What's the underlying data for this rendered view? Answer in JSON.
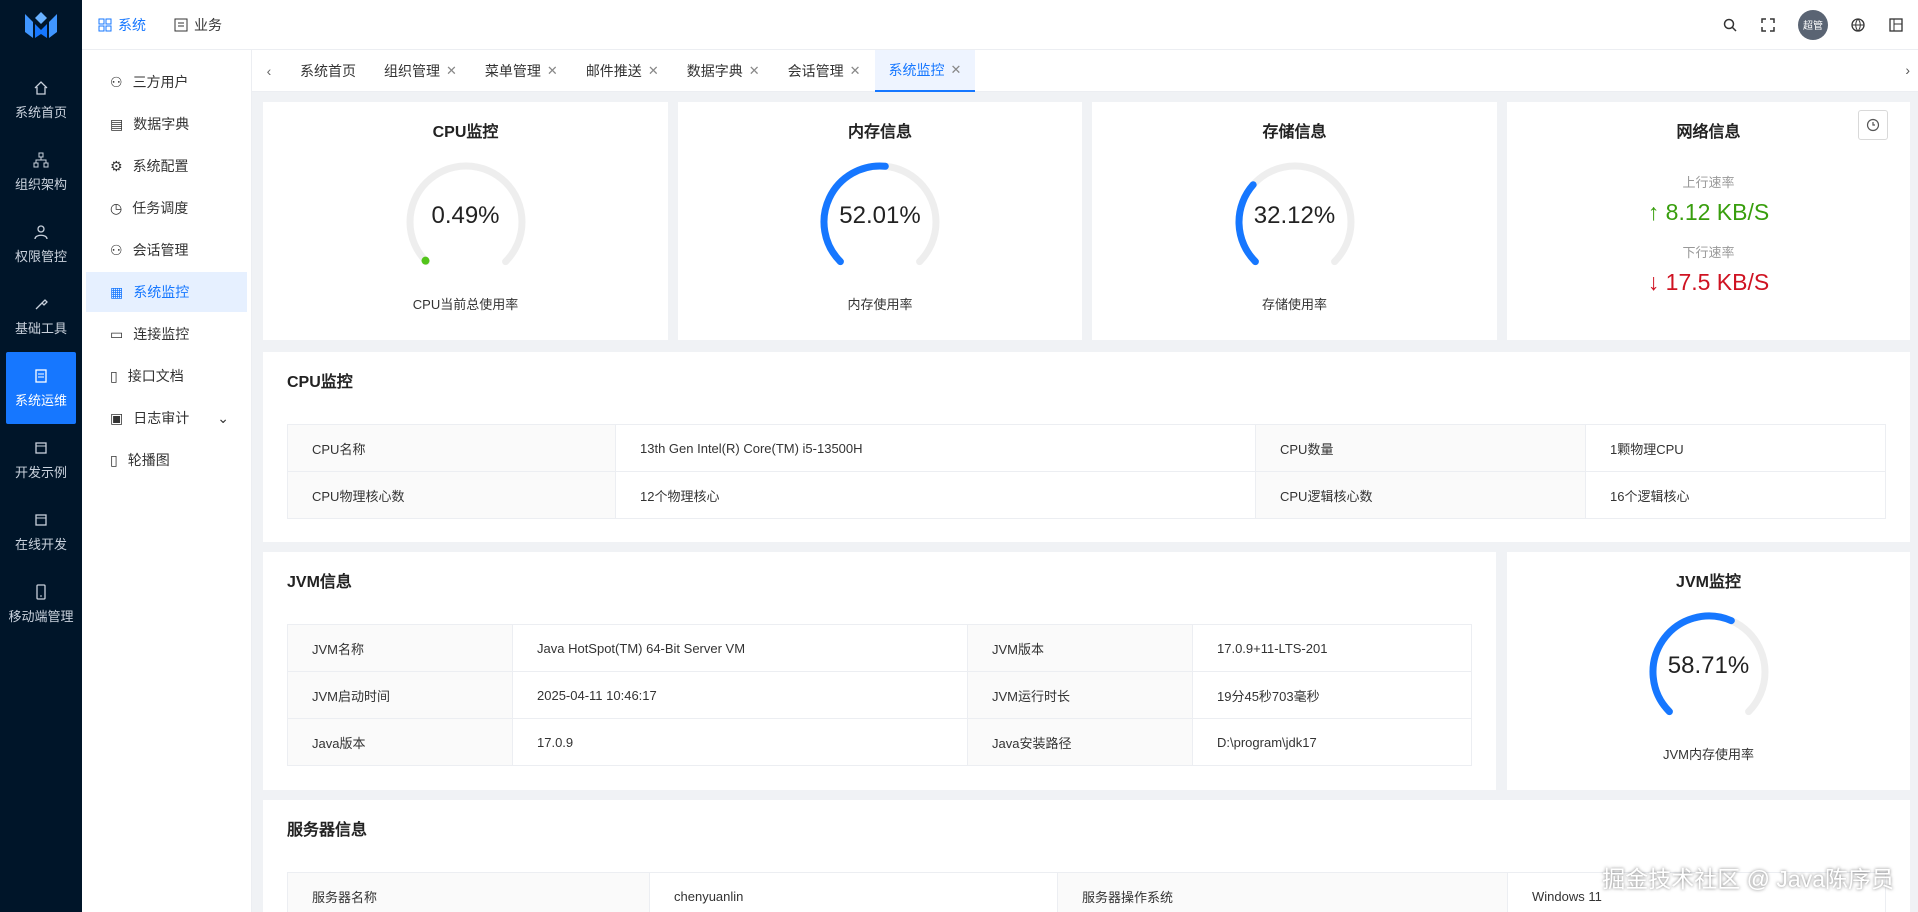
{
  "rail": {
    "items": [
      {
        "label": "系统首页",
        "icon": "home-icon"
      },
      {
        "label": "组织架构",
        "icon": "org-icon"
      },
      {
        "label": "权限管控",
        "icon": "user-icon"
      },
      {
        "label": "基础工具",
        "icon": "wrench-icon"
      },
      {
        "label": "系统运维",
        "icon": "doc-icon"
      },
      {
        "label": "开发示例",
        "icon": "box-icon"
      },
      {
        "label": "在线开发",
        "icon": "box-icon"
      },
      {
        "label": "移动端管理",
        "icon": "phone-icon"
      }
    ]
  },
  "header": {
    "menu": [
      {
        "label": "系统"
      },
      {
        "label": "业务"
      }
    ],
    "avatar_text": "超管"
  },
  "sidemenu": {
    "items": [
      {
        "label": "三方用户"
      },
      {
        "label": "数据字典"
      },
      {
        "label": "系统配置"
      },
      {
        "label": "任务调度"
      },
      {
        "label": "会话管理"
      },
      {
        "label": "系统监控"
      },
      {
        "label": "连接监控"
      },
      {
        "label": "接口文档"
      },
      {
        "label": "日志审计"
      },
      {
        "label": "轮播图"
      }
    ]
  },
  "tabs": [
    {
      "label": "系统首页"
    },
    {
      "label": "组织管理"
    },
    {
      "label": "菜单管理"
    },
    {
      "label": "邮件推送"
    },
    {
      "label": "数据字典"
    },
    {
      "label": "会话管理"
    },
    {
      "label": "系统监控"
    }
  ],
  "gauges": {
    "cpu": {
      "title": "CPU监控",
      "value_text": "0.49%",
      "value": 0.49,
      "sub": "CPU当前总使用率"
    },
    "mem": {
      "title": "内存信息",
      "value_text": "52.01%",
      "value": 52.01,
      "sub": "内存使用率"
    },
    "disk": {
      "title": "存储信息",
      "value_text": "32.12%",
      "value": 32.12,
      "sub": "存储使用率"
    },
    "jvm": {
      "title": "JVM监控",
      "value_text": "58.71%",
      "value": 58.71,
      "sub": "JVM内存使用率"
    }
  },
  "network": {
    "title": "网络信息",
    "up_label": "上行速率",
    "up_value": "8.12 KB/S",
    "down_label": "下行速率",
    "down_value": "17.5 KB/S"
  },
  "cpu_section": {
    "title": "CPU监控",
    "rows": [
      [
        "CPU名称",
        "13th Gen Intel(R) Core(TM) i5-13500H",
        "CPU数量",
        "1颗物理CPU"
      ],
      [
        "CPU物理核心数",
        "12个物理核心",
        "CPU逻辑核心数",
        "16个逻辑核心"
      ]
    ]
  },
  "jvm_section": {
    "title": "JVM信息",
    "rows": [
      [
        "JVM名称",
        "Java HotSpot(TM) 64-Bit Server VM",
        "JVM版本",
        "17.0.9+11-LTS-201"
      ],
      [
        "JVM启动时间",
        "2025-04-11 10:46:17",
        "JVM运行时长",
        "19分45秒703毫秒"
      ],
      [
        "Java版本",
        "17.0.9",
        "Java安装路径",
        "D:\\program\\jdk17"
      ]
    ]
  },
  "server_section": {
    "title": "服务器信息",
    "rows": [
      [
        "服务器名称",
        "chenyuanlin",
        "服务器操作系统",
        "Windows 11"
      ]
    ]
  },
  "watermark": "掘金技术社区 @ Java陈序员",
  "colors": {
    "accent": "#1677ff",
    "up": "#389e0d",
    "down": "#cf1322",
    "rail": "#001529"
  }
}
